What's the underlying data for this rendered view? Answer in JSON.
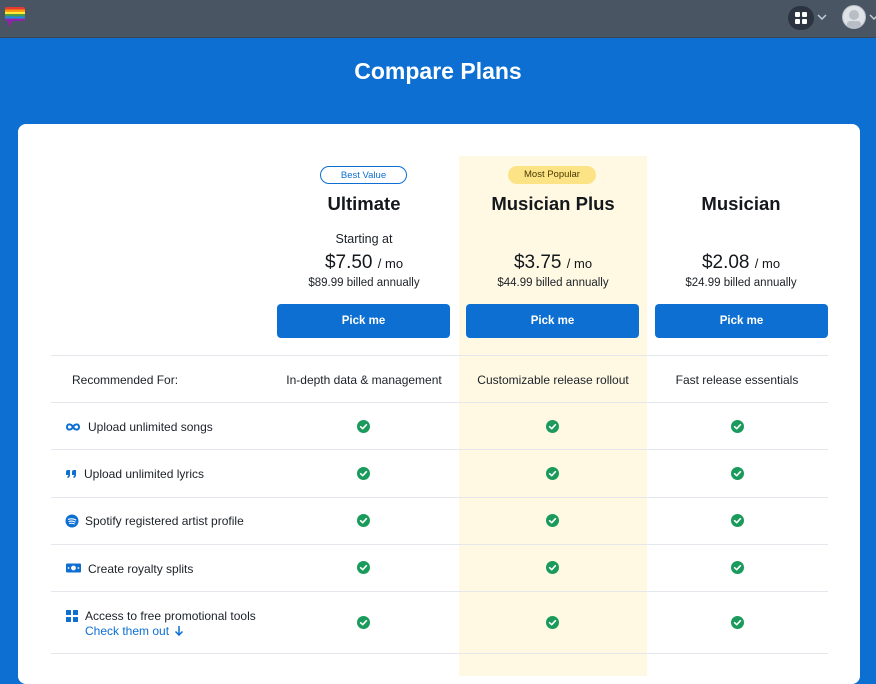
{
  "page": {
    "title": "Compare Plans"
  },
  "header": {
    "apps_icon": "grid-icon",
    "avatar_icon": "user-avatar"
  },
  "plans": [
    {
      "badge": "Best Value",
      "name": "Ultimate",
      "starting": "Starting at",
      "price": "$7.50",
      "unit": "/ mo",
      "billed": "$89.99 billed annually",
      "cta": "Pick me",
      "recommended": "In-depth data & management"
    },
    {
      "badge": "Most Popular",
      "name": "Musician Plus",
      "starting": "",
      "price": "$3.75",
      "unit": "/ mo",
      "billed": "$44.99 billed annually",
      "cta": "Pick me",
      "recommended": "Customizable release rollout"
    },
    {
      "badge": "",
      "name": "Musician",
      "starting": "",
      "price": "$2.08",
      "unit": "/ mo",
      "billed": "$24.99 billed annually",
      "cta": "Pick me",
      "recommended": "Fast release essentials"
    }
  ],
  "recommended_label": "Recommended For:",
  "features": [
    {
      "label": "Upload unlimited songs",
      "icon": "infinity-icon"
    },
    {
      "label": "Upload unlimited lyrics",
      "icon": "quote-icon"
    },
    {
      "label": "Spotify registered artist profile",
      "icon": "spotify-icon"
    },
    {
      "label": "Create royalty splits",
      "icon": "money-icon"
    },
    {
      "label": "Access to free promotional tools",
      "icon": "grid-tools-icon",
      "link": "Check them out"
    }
  ],
  "colors": {
    "accent": "#0d6fd1",
    "highlight": "#fff9e3",
    "check": "#1a9b5c",
    "badge_popular": "#fbe386"
  }
}
